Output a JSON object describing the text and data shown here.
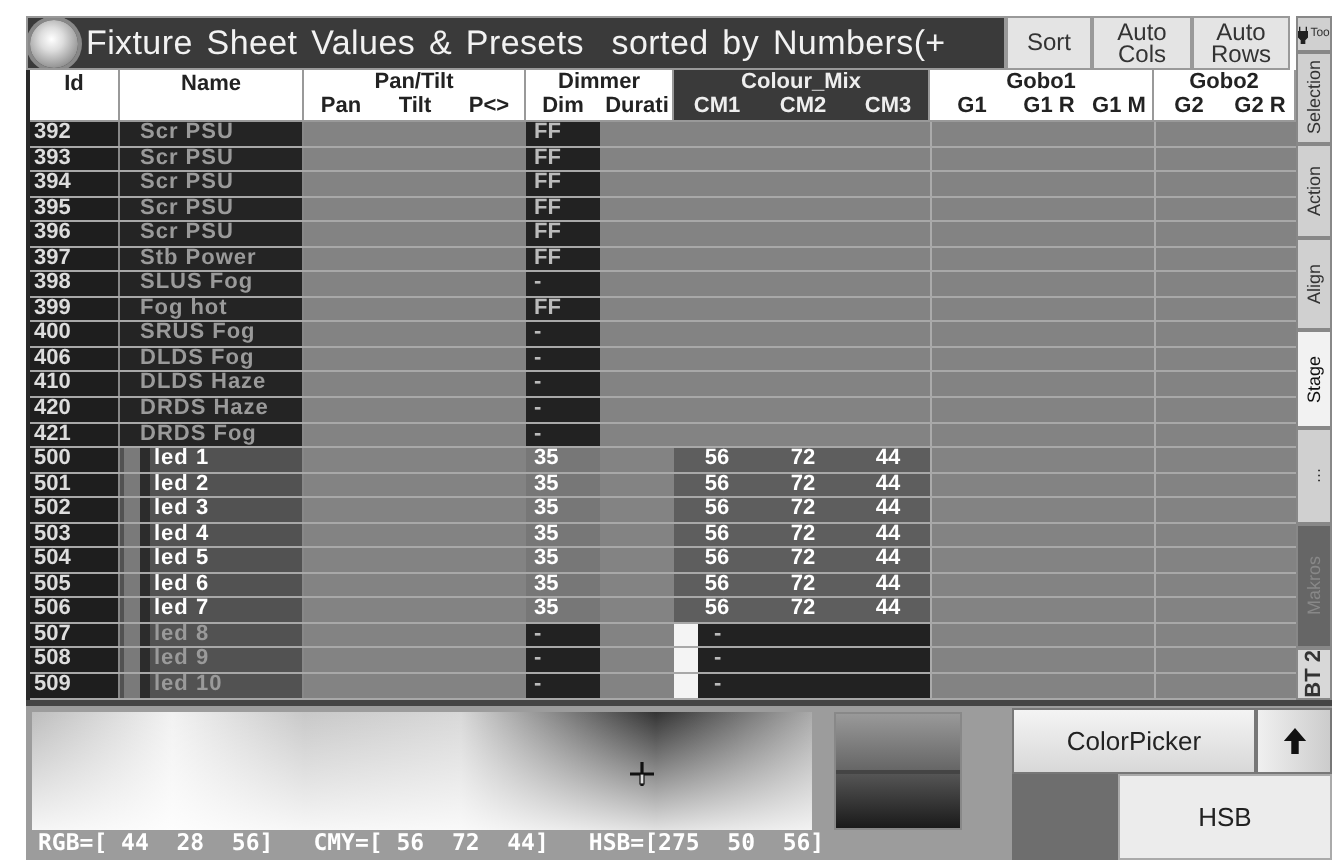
{
  "window": {
    "title": "Fixture Sheet Values & Presets  sorted by Numbers(+"
  },
  "toolbar": [
    "Sort",
    "Auto Cols",
    "Auto Rows"
  ],
  "column_groups": [
    {
      "label": "Id",
      "highlighted": false
    },
    {
      "label": "Name",
      "highlighted": false
    },
    {
      "label": "Pan/Tilt",
      "columns": [
        "Pan",
        "Tilt",
        "P<>"
      ],
      "highlighted": false
    },
    {
      "label": "Dimmer",
      "columns": [
        "Dim",
        "Durati"
      ],
      "highlighted": false
    },
    {
      "label": "Colour_Mix",
      "columns": [
        "CM1",
        "CM2",
        "CM3"
      ],
      "highlighted": true
    },
    {
      "label": "Gobo1",
      "columns": [
        "G1",
        "G1 R",
        "G1 M"
      ],
      "highlighted": false
    },
    {
      "label": "Gobo2",
      "columns": [
        "G2",
        "G2 R"
      ],
      "highlighted": false
    }
  ],
  "rows": [
    {
      "id": "392",
      "name": "Scr PSU",
      "kind": "plain",
      "active": false,
      "dim": "FF"
    },
    {
      "id": "393",
      "name": "Scr PSU",
      "kind": "plain",
      "active": false,
      "dim": "FF"
    },
    {
      "id": "394",
      "name": "Scr PSU",
      "kind": "plain",
      "active": false,
      "dim": "FF"
    },
    {
      "id": "395",
      "name": "Scr PSU",
      "kind": "plain",
      "active": false,
      "dim": "FF"
    },
    {
      "id": "396",
      "name": "Scr PSU",
      "kind": "plain",
      "active": false,
      "dim": "FF"
    },
    {
      "id": "397",
      "name": "Stb Power",
      "kind": "plain",
      "active": false,
      "dim": "FF"
    },
    {
      "id": "398",
      "name": "SLUS Fog",
      "kind": "plain",
      "active": false,
      "dim": "-"
    },
    {
      "id": "399",
      "name": "Fog hot",
      "kind": "plain",
      "active": false,
      "dim": "FF"
    },
    {
      "id": "400",
      "name": "SRUS Fog",
      "kind": "plain",
      "active": false,
      "dim": "-"
    },
    {
      "id": "406",
      "name": "DLDS Fog",
      "kind": "plain",
      "active": false,
      "dim": "-"
    },
    {
      "id": "410",
      "name": "DLDS Haze",
      "kind": "plain",
      "active": false,
      "dim": "-"
    },
    {
      "id": "420",
      "name": "DRDS Haze",
      "kind": "plain",
      "active": false,
      "dim": "-"
    },
    {
      "id": "421",
      "name": "DRDS Fog",
      "kind": "plain",
      "active": false,
      "dim": "-"
    },
    {
      "id": "500",
      "name": "led 1",
      "kind": "led",
      "active": true,
      "dim": "35",
      "cm": [
        "56",
        "72",
        "44"
      ]
    },
    {
      "id": "501",
      "name": "led 2",
      "kind": "led",
      "active": true,
      "dim": "35",
      "cm": [
        "56",
        "72",
        "44"
      ]
    },
    {
      "id": "502",
      "name": "led 3",
      "kind": "led",
      "active": true,
      "dim": "35",
      "cm": [
        "56",
        "72",
        "44"
      ]
    },
    {
      "id": "503",
      "name": "led 4",
      "kind": "led",
      "active": true,
      "dim": "35",
      "cm": [
        "56",
        "72",
        "44"
      ]
    },
    {
      "id": "504",
      "name": "led 5",
      "kind": "led",
      "active": true,
      "dim": "35",
      "cm": [
        "56",
        "72",
        "44"
      ]
    },
    {
      "id": "505",
      "name": "led 6",
      "kind": "led",
      "active": true,
      "dim": "35",
      "cm": [
        "56",
        "72",
        "44"
      ]
    },
    {
      "id": "506",
      "name": "led 7",
      "kind": "led",
      "active": true,
      "dim": "35",
      "cm": [
        "56",
        "72",
        "44"
      ]
    },
    {
      "id": "507",
      "name": "led 8",
      "kind": "led",
      "active": false,
      "dim": "-",
      "cm": [
        "-"
      ]
    },
    {
      "id": "508",
      "name": "led 9",
      "kind": "led",
      "active": false,
      "dim": "-",
      "cm": [
        "-"
      ]
    },
    {
      "id": "509",
      "name": "led 10",
      "kind": "led",
      "active": false,
      "dim": "-",
      "cm": [
        "-"
      ]
    }
  ],
  "side_tabs": [
    {
      "label": "Too",
      "kind": "tools",
      "selected": false,
      "disabled": false
    },
    {
      "label": "Selection",
      "kind": "view",
      "selected": false,
      "disabled": false
    },
    {
      "label": "Action",
      "kind": "view",
      "selected": false,
      "disabled": false
    },
    {
      "label": "Align",
      "kind": "view",
      "selected": false,
      "disabled": false
    },
    {
      "label": "Stage",
      "kind": "view",
      "selected": true,
      "disabled": false
    },
    {
      "label": "...",
      "kind": "view",
      "selected": false,
      "disabled": false
    },
    {
      "label": "Makros",
      "kind": "view",
      "selected": false,
      "disabled": true
    },
    {
      "label": "BT 2",
      "kind": "bank",
      "selected": false,
      "disabled": false
    }
  ],
  "color_picker": {
    "readouts": [
      "RGB=[ 44  28  56]",
      "CMY=[ 56  72  44]",
      "HSB=[275  50  56]"
    ],
    "title_button": "ColorPicker",
    "mode_button": "HSB"
  }
}
